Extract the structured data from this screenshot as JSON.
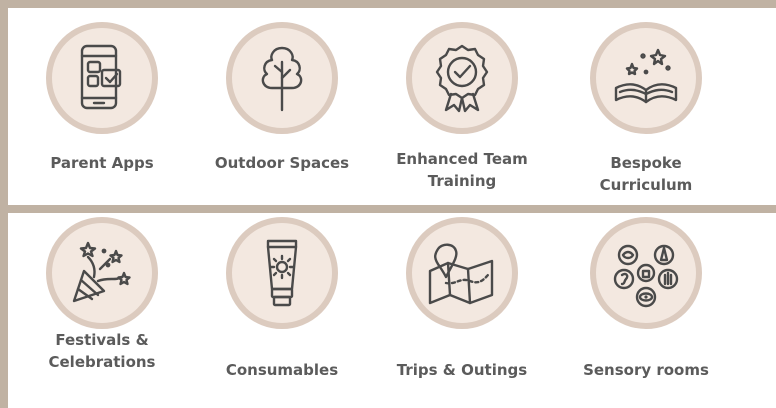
{
  "features": [
    {
      "label": "Parent Apps",
      "icon": "phone-apps-icon"
    },
    {
      "label": "Outdoor Spaces",
      "icon": "tree-icon"
    },
    {
      "label": "Enhanced Team Training",
      "icon": "award-badge-icon"
    },
    {
      "label": "Bespoke Curriculum",
      "icon": "open-book-stars-icon"
    },
    {
      "label": "Festivals & Celebrations",
      "icon": "party-popper-icon"
    },
    {
      "label": "Consumables",
      "icon": "sunscreen-tube-icon"
    },
    {
      "label": "Trips & Outings",
      "icon": "map-pin-icon"
    },
    {
      "label": "Sensory rooms",
      "icon": "senses-icon"
    }
  ],
  "colors": {
    "frame": "#c0b2a3",
    "panel": "#ffffff",
    "circle_fill": "#f3e8e0",
    "circle_ring": "#dccbbf",
    "text": "#5b5b5b"
  }
}
